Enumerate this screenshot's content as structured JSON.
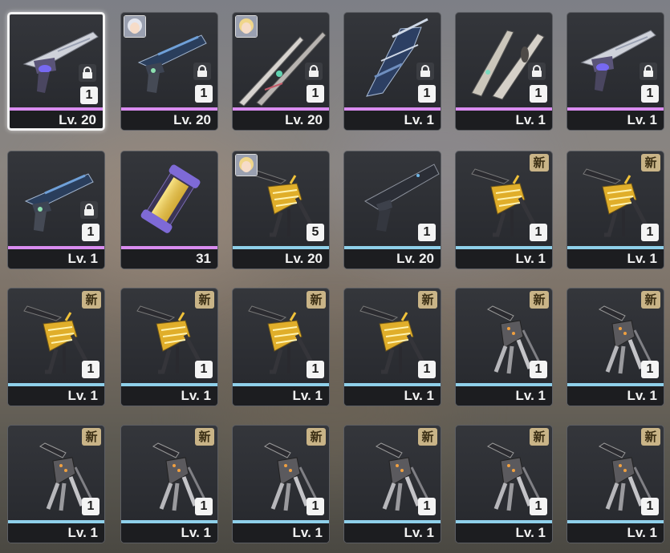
{
  "inventory": {
    "rows": [
      [
        {
          "level": "Lv. 20",
          "count": "1",
          "locked": true,
          "new": false,
          "rarity": "purple",
          "icon": "silver-pistol-icon",
          "avatar": null,
          "selected": true
        },
        {
          "level": "Lv. 20",
          "count": "1",
          "locked": true,
          "new": false,
          "rarity": "purple",
          "icon": "blue-revolver-icon",
          "avatar": "silver-hair-avatar",
          "selected": false
        },
        {
          "level": "Lv. 20",
          "count": "1",
          "locked": true,
          "new": false,
          "rarity": "purple",
          "icon": "twin-blades-icon",
          "avatar": "blonde-avatar",
          "selected": false
        },
        {
          "level": "Lv. 1",
          "count": "1",
          "locked": true,
          "new": false,
          "rarity": "purple",
          "icon": "spiked-launcher-icon",
          "avatar": null,
          "selected": false
        },
        {
          "level": "Lv. 1",
          "count": "1",
          "locked": true,
          "new": false,
          "rarity": "purple",
          "icon": "twin-daggers-icon",
          "avatar": null,
          "selected": false
        },
        {
          "level": "Lv. 1",
          "count": "1",
          "locked": true,
          "new": false,
          "rarity": "purple",
          "icon": "silver-pistol-icon",
          "avatar": null,
          "selected": false
        }
      ],
      [
        {
          "level": "Lv. 1",
          "count": "1",
          "locked": true,
          "new": false,
          "rarity": "purple",
          "icon": "blue-revolver-icon",
          "avatar": null,
          "selected": false
        },
        {
          "level": "31",
          "count": "",
          "locked": false,
          "new": false,
          "rarity": "purple",
          "icon": "energy-capsule-icon",
          "avatar": null,
          "selected": false
        },
        {
          "level": "Lv. 20",
          "count": "5",
          "locked": false,
          "new": false,
          "rarity": "blue",
          "icon": "gold-claw-icon",
          "avatar": "blonde-avatar",
          "selected": false
        },
        {
          "level": "Lv. 20",
          "count": "1",
          "locked": false,
          "new": false,
          "rarity": "blue",
          "icon": "black-pistol-icon",
          "avatar": null,
          "selected": false
        },
        {
          "level": "Lv. 1",
          "count": "1",
          "locked": false,
          "new": true,
          "rarity": "blue",
          "icon": "gold-claw-icon",
          "avatar": null,
          "selected": false
        },
        {
          "level": "Lv. 1",
          "count": "1",
          "locked": false,
          "new": true,
          "rarity": "blue",
          "icon": "gold-claw-icon",
          "avatar": null,
          "selected": false
        }
      ],
      [
        {
          "level": "Lv. 1",
          "count": "1",
          "locked": false,
          "new": true,
          "rarity": "blue",
          "icon": "gold-claw-icon",
          "avatar": null,
          "selected": false
        },
        {
          "level": "Lv. 1",
          "count": "1",
          "locked": false,
          "new": true,
          "rarity": "blue",
          "icon": "gold-claw-icon",
          "avatar": null,
          "selected": false
        },
        {
          "level": "Lv. 1",
          "count": "1",
          "locked": false,
          "new": true,
          "rarity": "blue",
          "icon": "gold-claw-icon",
          "avatar": null,
          "selected": false
        },
        {
          "level": "Lv. 1",
          "count": "1",
          "locked": false,
          "new": true,
          "rarity": "blue",
          "icon": "gold-claw-icon",
          "avatar": null,
          "selected": false
        },
        {
          "level": "Lv. 1",
          "count": "1",
          "locked": false,
          "new": true,
          "rarity": "blue",
          "icon": "silver-claw-icon",
          "avatar": null,
          "selected": false
        },
        {
          "level": "Lv. 1",
          "count": "1",
          "locked": false,
          "new": true,
          "rarity": "blue",
          "icon": "silver-claw-icon",
          "avatar": null,
          "selected": false
        }
      ],
      [
        {
          "level": "Lv. 1",
          "count": "1",
          "locked": false,
          "new": true,
          "rarity": "blue",
          "icon": "silver-claw-icon",
          "avatar": null,
          "selected": false
        },
        {
          "level": "Lv. 1",
          "count": "1",
          "locked": false,
          "new": true,
          "rarity": "blue",
          "icon": "silver-claw-icon",
          "avatar": null,
          "selected": false
        },
        {
          "level": "Lv. 1",
          "count": "1",
          "locked": false,
          "new": true,
          "rarity": "blue",
          "icon": "silver-claw-icon",
          "avatar": null,
          "selected": false
        },
        {
          "level": "Lv. 1",
          "count": "1",
          "locked": false,
          "new": true,
          "rarity": "blue",
          "icon": "silver-claw-icon",
          "avatar": null,
          "selected": false
        },
        {
          "level": "Lv. 1",
          "count": "1",
          "locked": false,
          "new": true,
          "rarity": "blue",
          "icon": "silver-claw-icon",
          "avatar": null,
          "selected": false
        },
        {
          "level": "Lv. 1",
          "count": "1",
          "locked": false,
          "new": true,
          "rarity": "blue",
          "icon": "silver-claw-icon",
          "avatar": null,
          "selected": false
        }
      ]
    ],
    "new_badge_label": "新",
    "colors": {
      "purple": "#d98cf0",
      "blue": "#8fd0ea",
      "selected_border": "#f4f4f4",
      "new_badge": "#c9b487"
    }
  }
}
